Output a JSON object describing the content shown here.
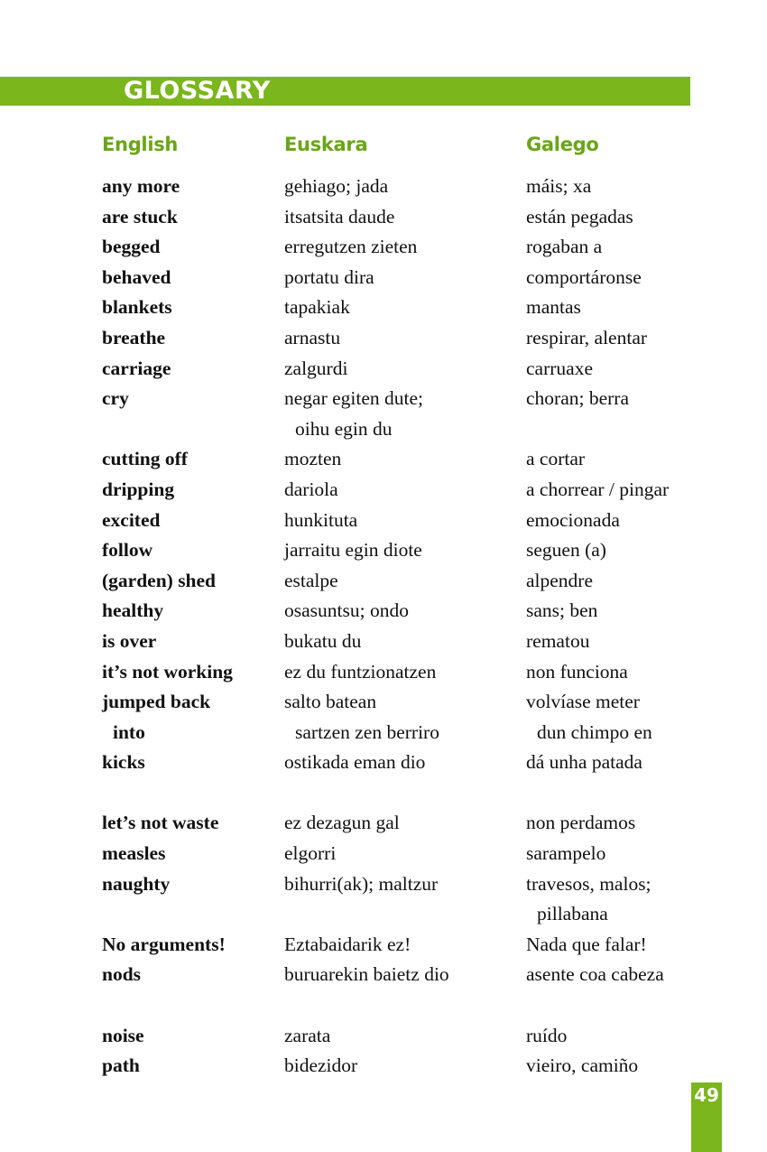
{
  "header": {
    "title": "GLOSSARY",
    "columns": {
      "english": "English",
      "euskara": "Euskara",
      "galego": "Galego"
    }
  },
  "rows": [
    {
      "en": "any more",
      "eu": "gehiago; jada",
      "gl": "máis; xa"
    },
    {
      "en": "are stuck",
      "eu": "itsatsita daude",
      "gl": "están pegadas"
    },
    {
      "en": "begged",
      "eu": "erregutzen zieten",
      "gl": "rogaban a"
    },
    {
      "en": "behaved",
      "eu": "portatu dira",
      "gl": "comportáronse"
    },
    {
      "en": "blankets",
      "eu": "tapakiak",
      "gl": "mantas"
    },
    {
      "en": "breathe",
      "eu": "arnastu",
      "gl": "respirar, alentar"
    },
    {
      "en": "carriage",
      "eu": "zalgurdi",
      "gl": "carruaxe"
    },
    {
      "en": "cry",
      "eu": "negar egiten dute;",
      "gl": "choran; berra"
    },
    {
      "en": "",
      "eu": "oihu egin du",
      "gl": "",
      "indent": true
    },
    {
      "en": "cutting off",
      "eu": "mozten",
      "gl": "a cortar"
    },
    {
      "en": "dripping",
      "eu": "dariola",
      "gl": "a chorrear / pingar"
    },
    {
      "en": "excited",
      "eu": "hunkituta",
      "gl": "emocionada"
    },
    {
      "en": "follow",
      "eu": "jarraitu egin diote",
      "gl": "seguen (a)"
    },
    {
      "en": "(garden) shed",
      "eu": "estalpe",
      "gl": "alpendre"
    },
    {
      "en": "healthy",
      "eu": "osasuntsu; ondo",
      "gl": "sans; ben"
    },
    {
      "en": "is over",
      "eu": "bukatu du",
      "gl": "rematou"
    },
    {
      "en": "it’s not working",
      "eu": "ez du funtzionatzen",
      "gl": "non funciona"
    },
    {
      "en": "jumped back",
      "eu": "salto batean",
      "gl": "volvíase meter"
    },
    {
      "en": "into",
      "eu": "sartzen zen berriro",
      "gl": "dun chimpo en",
      "indent": true
    },
    {
      "en": "kicks",
      "eu": "ostikada eman dio",
      "gl": "dá unha patada"
    },
    {
      "en": "",
      "eu": "",
      "gl": ""
    },
    {
      "en": "let’s not waste",
      "eu": "ez dezagun gal",
      "gl": "non perdamos"
    },
    {
      "en": "measles",
      "eu": "elgorri",
      "gl": "sarampelo"
    },
    {
      "en": "naughty",
      "eu": "bihurri(ak); maltzur",
      "gl": "travesos, malos;"
    },
    {
      "en": "",
      "eu": "",
      "gl": "pillabana",
      "indent": true
    },
    {
      "en": "No arguments!",
      "eu": "Eztabaidarik ez!",
      "gl": "Nada que falar!"
    },
    {
      "en": "nods",
      "eu": "buruarekin baietz dio",
      "gl": "asente coa cabeza"
    },
    {
      "en": "",
      "eu": "",
      "gl": ""
    },
    {
      "en": "noise",
      "eu": "zarata",
      "gl": "ruído"
    },
    {
      "en": "path",
      "eu": "bidezidor",
      "gl": "vieiro, camiño"
    }
  ],
  "footer": {
    "page_number": "49"
  },
  "colors": {
    "accent": "#7ab61c",
    "heading": "#6aa518",
    "text": "#111111"
  }
}
